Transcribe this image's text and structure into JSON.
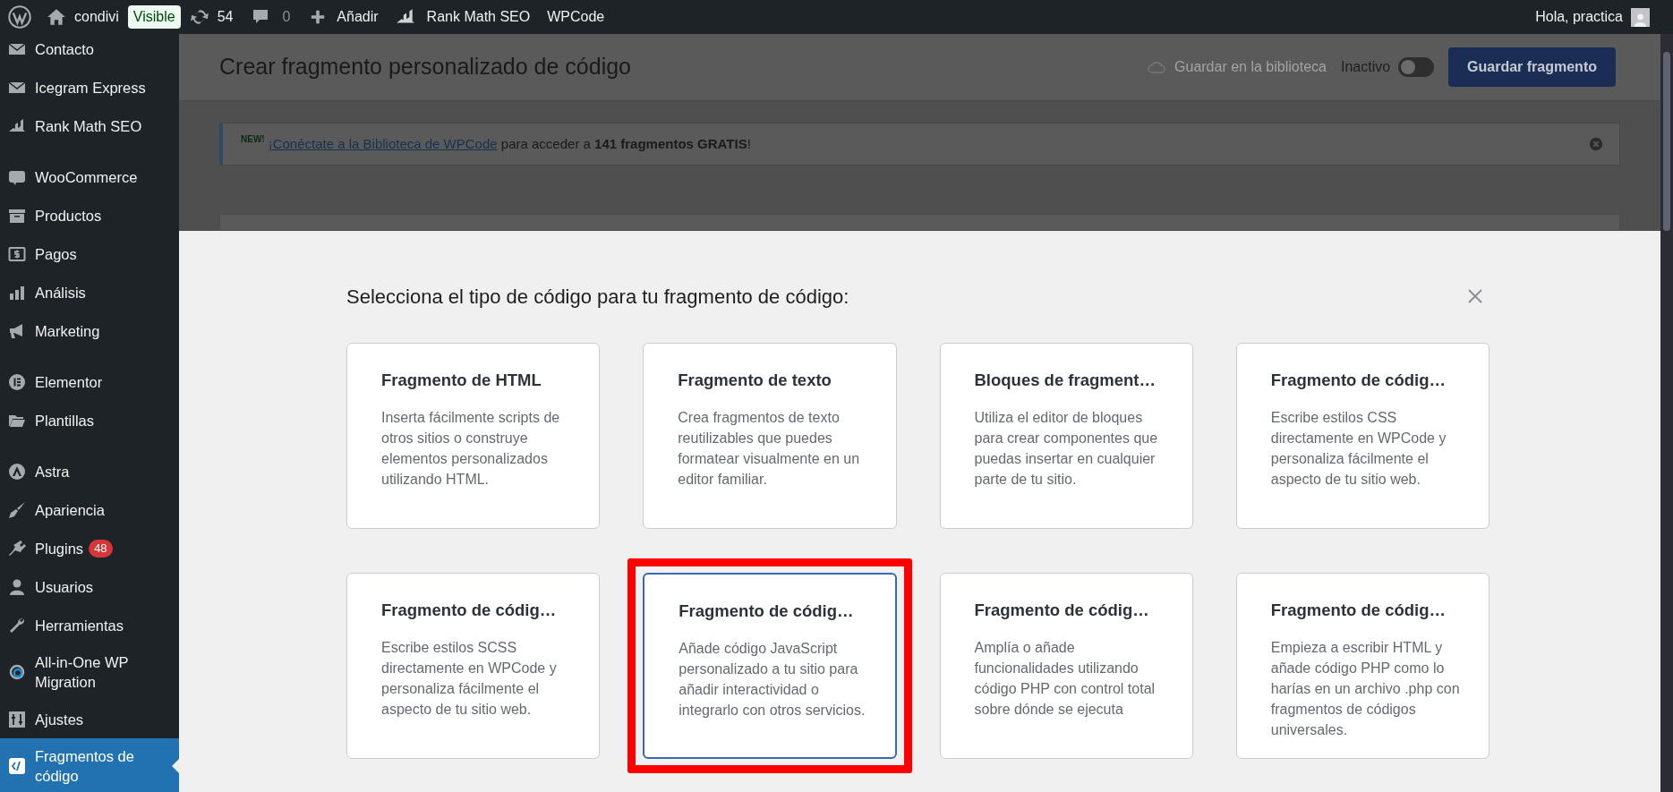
{
  "admin_bar": {
    "site_name": "condivi",
    "visibility_badge": "Visible",
    "updates_count": "54",
    "comments_count": "0",
    "new_label": "Añadir",
    "rank_math_label": "Rank Math SEO",
    "wpcode_label": "WPCode",
    "greeting": "Hola, practica"
  },
  "sidebar": {
    "groups": [
      [
        {
          "label": "Contacto",
          "selected": false
        },
        {
          "label": "Icegram Express",
          "selected": false
        },
        {
          "label": "Rank Math SEO",
          "selected": false
        }
      ],
      [
        {
          "label": "WooCommerce",
          "selected": false
        },
        {
          "label": "Productos",
          "selected": false
        },
        {
          "label": "Pagos",
          "selected": false
        },
        {
          "label": "Análisis",
          "selected": false
        },
        {
          "label": "Marketing",
          "selected": false
        }
      ],
      [
        {
          "label": "Elementor",
          "selected": false
        },
        {
          "label": "Plantillas",
          "selected": false
        }
      ],
      [
        {
          "label": "Astra",
          "selected": false
        },
        {
          "label": "Apariencia",
          "selected": false
        },
        {
          "label": "Plugins",
          "badge": "48",
          "selected": false
        },
        {
          "label": "Usuarios",
          "selected": false
        },
        {
          "label": "Herramientas",
          "selected": false
        },
        {
          "label": "All-in-One WP Migration",
          "selected": false
        },
        {
          "label": "Ajustes",
          "selected": false
        },
        {
          "label": "Fragmentos de código",
          "selected": true
        }
      ]
    ]
  },
  "header": {
    "title": "Crear fragmento personalizado de código",
    "save_to_library": "Guardar en la biblioteca",
    "status_toggle": {
      "label": "Inactivo",
      "on": false
    },
    "save_button": "Guardar fragmento"
  },
  "notice": {
    "tag": "NEW!",
    "link": "¡Conéctate a la Biblioteca de WPCode",
    "text": " para acceder a **141 fragmentos GRATIS**!"
  },
  "modal": {
    "title": "Selecciona el tipo de código para tu fragmento de código:",
    "cards": [
      {
        "title": "Fragmento de HTML",
        "description": "Inserta fácilmente scripts de otros sitios o construye elementos personalizados utilizando HTML.",
        "selected": false,
        "highlighted": false
      },
      {
        "title": "Fragmento de texto",
        "description": "Crea fragmentos de texto reutilizables que puedes formatear visualmente en un editor familiar.",
        "selected": false,
        "highlighted": false
      },
      {
        "title": "Bloques de fragment…",
        "description": "Utiliza el editor de bloques para crear componentes que puedas insertar en cualquier parte de tu sitio.",
        "selected": false,
        "highlighted": false
      },
      {
        "title": "Fragmento de códig…",
        "description": "Escribe estilos CSS directamente en WPCode y personaliza fácilmente el aspecto de tu sitio web.",
        "selected": false,
        "highlighted": false
      },
      {
        "title": "Fragmento de códig…",
        "description": "Escribe estilos SCSS directamente en WPCode y personaliza fácilmente el aspecto de tu sitio web.",
        "selected": false,
        "highlighted": false
      },
      {
        "title": "Fragmento de códig…",
        "description": "Añade código JavaScript personalizado a tu sitio para añadir interactividad o integrarlo con otros servicios.",
        "selected": true,
        "highlighted": true
      },
      {
        "title": "Fragmento de códig…",
        "description": "Amplía o añade funcionalidades utilizando código PHP con control total sobre dónde se ejecuta",
        "selected": false,
        "highlighted": false
      },
      {
        "title": "Fragmento de códig…",
        "description": "Empieza a escribir HTML y añade código PHP como lo harías en un archivo .php con fragmentos de códigos universales.",
        "selected": false,
        "highlighted": false
      }
    ]
  }
}
